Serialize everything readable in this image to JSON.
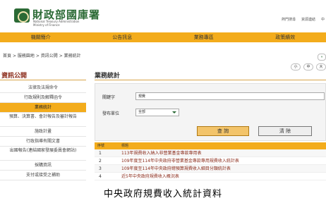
{
  "header": {
    "site_title": "財政部國庫署",
    "subtitle_line1": "National Treasury Administration",
    "subtitle_line2": "Ministry of Finance",
    "top_links": [
      "熱門搜尋",
      "資源連結",
      "中"
    ]
  },
  "nav": {
    "items": [
      "機關簡介",
      "公告訊息",
      "業務專區",
      "政策績效"
    ]
  },
  "breadcrumb": {
    "items": [
      "首頁",
      "服務園地",
      "資訊公開",
      "業務統計"
    ],
    "separator": ">"
  },
  "font_size_buttons": [
    "小",
    "中",
    "大"
  ],
  "sidebar": {
    "title": "資訊公開",
    "items": [
      "法律及法規命令",
      "行政規則及解釋函令",
      "業務統計",
      "預算、決算書、會計報告及審計報告",
      "施政計畫",
      "行政指導有關文書",
      "出國報告(連結國家發展委員會網站)",
      "採購資訊",
      "支付或接受之補助"
    ],
    "active_index": 2
  },
  "main": {
    "title": "業務統計",
    "search": {
      "keyword_label": "關鍵字",
      "keyword_value": "規費",
      "unit_label": "發布單位",
      "unit_value": "全部",
      "query_button": "查 詢",
      "clear_button": "清 除"
    },
    "table": {
      "headers": [
        "序號",
        "標題"
      ],
      "rows": [
        {
          "no": "1",
          "title": "113年規費收入納入非營業基金專款專用表"
        },
        {
          "no": "2",
          "title": "109年度至114年中央政府非營業基金專款專用規費收入統計表"
        },
        {
          "no": "3",
          "title": "109年度至114年中央政府總預算規費收入細目分類統計表"
        },
        {
          "no": "4",
          "title": "近5年中央政府規費收入概況表"
        }
      ]
    }
  },
  "caption": "中央政府規費收入統計資料",
  "colors": {
    "brand_green": "#2b6a35",
    "nav_orange": "#f3ac1c",
    "link_red": "#8b2b1a"
  }
}
